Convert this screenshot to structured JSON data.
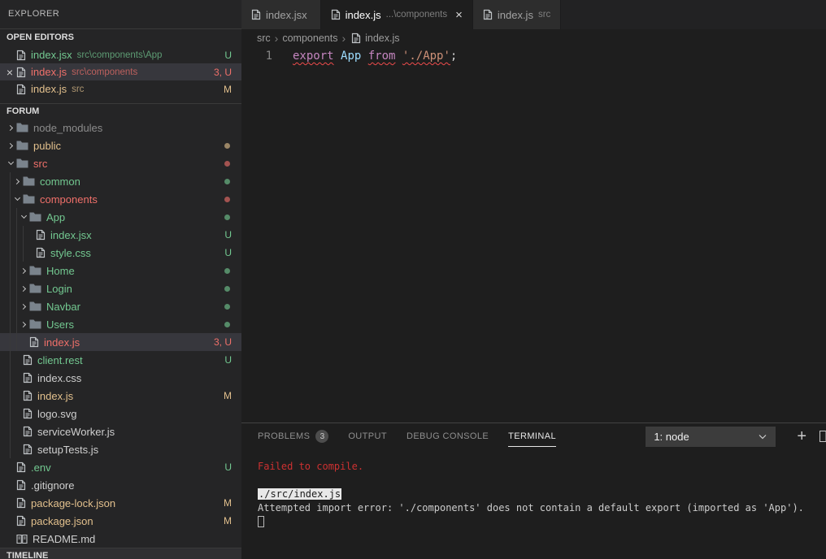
{
  "colors": {
    "green": "#73C991",
    "red": "#F0706A",
    "yellow": "#E2C08D",
    "gray": "#8C8C8C",
    "default": "#CFCFCF",
    "terminal_red": "#CD3131",
    "squiggle": "#F14C4C",
    "selection_bg": "#37373D"
  },
  "sidebar": {
    "title": "EXPLORER",
    "open_editors": {
      "header": "OPEN EDITORS",
      "items": [
        {
          "name": "index.jsx",
          "desc": "src\\components\\App",
          "badge": "U",
          "color": "green",
          "selected": false,
          "close": false
        },
        {
          "name": "index.js",
          "desc": "src\\components",
          "badge": "3, U",
          "color": "red",
          "selected": true,
          "close": true
        },
        {
          "name": "index.js",
          "desc": "src",
          "badge": "M",
          "color": "yellow",
          "selected": false,
          "close": false
        }
      ]
    },
    "tree": {
      "header": "FORUM",
      "items": [
        {
          "type": "folder",
          "level": 0,
          "name": "node_modules",
          "expanded": false,
          "color": "gray",
          "dot": ""
        },
        {
          "type": "folder",
          "level": 0,
          "name": "public",
          "expanded": false,
          "color": "yellow",
          "dot": "yellow"
        },
        {
          "type": "folder",
          "level": 0,
          "name": "src",
          "expanded": true,
          "color": "red",
          "dot": "red"
        },
        {
          "type": "folder",
          "level": 1,
          "name": "common",
          "expanded": false,
          "color": "green",
          "dot": "green"
        },
        {
          "type": "folder",
          "level": 1,
          "name": "components",
          "expanded": true,
          "color": "red",
          "dot": "red"
        },
        {
          "type": "folder",
          "level": 2,
          "name": "App",
          "expanded": true,
          "color": "green",
          "dot": "green"
        },
        {
          "type": "file",
          "level": 3,
          "name": "index.jsx",
          "badge": "U",
          "color": "green",
          "selected": false
        },
        {
          "type": "file",
          "level": 3,
          "name": "style.css",
          "badge": "U",
          "color": "green",
          "selected": false
        },
        {
          "type": "folder",
          "level": 2,
          "name": "Home",
          "expanded": false,
          "color": "green",
          "dot": "green"
        },
        {
          "type": "folder",
          "level": 2,
          "name": "Login",
          "expanded": false,
          "color": "green",
          "dot": "green"
        },
        {
          "type": "folder",
          "level": 2,
          "name": "Navbar",
          "expanded": false,
          "color": "green",
          "dot": "green"
        },
        {
          "type": "folder",
          "level": 2,
          "name": "Users",
          "expanded": false,
          "color": "green",
          "dot": "green"
        },
        {
          "type": "file",
          "level": 2,
          "name": "index.js",
          "badge": "3, U",
          "color": "red",
          "selected": true
        },
        {
          "type": "file",
          "level": 1,
          "name": "client.rest",
          "badge": "U",
          "color": "green",
          "selected": false
        },
        {
          "type": "file",
          "level": 1,
          "name": "index.css",
          "badge": "",
          "color": "default",
          "selected": false
        },
        {
          "type": "file",
          "level": 1,
          "name": "index.js",
          "badge": "M",
          "color": "yellow",
          "selected": false
        },
        {
          "type": "file",
          "level": 1,
          "name": "logo.svg",
          "badge": "",
          "color": "default",
          "selected": false
        },
        {
          "type": "file",
          "level": 1,
          "name": "serviceWorker.js",
          "badge": "",
          "color": "default",
          "selected": false
        },
        {
          "type": "file",
          "level": 1,
          "name": "setupTests.js",
          "badge": "",
          "color": "default",
          "selected": false
        },
        {
          "type": "file",
          "level": 0,
          "name": ".env",
          "badge": "U",
          "color": "green",
          "selected": false
        },
        {
          "type": "file",
          "level": 0,
          "name": ".gitignore",
          "badge": "",
          "color": "default",
          "selected": false
        },
        {
          "type": "file",
          "level": 0,
          "name": "package-lock.json",
          "badge": "M",
          "color": "yellow",
          "selected": false
        },
        {
          "type": "file",
          "level": 0,
          "name": "package.json",
          "badge": "M",
          "color": "yellow",
          "selected": false
        },
        {
          "type": "file",
          "level": 0,
          "name": "README.md",
          "badge": "",
          "color": "default",
          "selected": false,
          "icon": "book"
        }
      ]
    },
    "timeline_header": "TIMELINE"
  },
  "editor": {
    "tabs": [
      {
        "name": "index.jsx",
        "desc": "",
        "active": false,
        "close": false
      },
      {
        "name": "index.js",
        "desc": "...\\components",
        "active": true,
        "close": true
      },
      {
        "name": "index.js",
        "desc": "src",
        "active": false,
        "close": false
      }
    ],
    "breadcrumb": [
      "src",
      "components",
      "index.js"
    ],
    "line_number": "1",
    "code_tokens": [
      {
        "text": "export",
        "color": "#C586C0",
        "squiggle": true
      },
      {
        "text": " ",
        "color": "#D4D4D4",
        "squiggle": false
      },
      {
        "text": "App",
        "color": "#9CDCFE",
        "squiggle": false
      },
      {
        "text": " ",
        "color": "#D4D4D4",
        "squiggle": false
      },
      {
        "text": "from",
        "color": "#C586C0",
        "squiggle": true
      },
      {
        "text": " ",
        "color": "#D4D4D4",
        "squiggle": false
      },
      {
        "text": "'./App'",
        "color": "#CE9178",
        "squiggle": true
      },
      {
        "text": ";",
        "color": "#D4D4D4",
        "squiggle": false
      }
    ]
  },
  "panel": {
    "tabs": [
      {
        "label": "PROBLEMS",
        "badge": "3",
        "active": false
      },
      {
        "label": "OUTPUT",
        "badge": "",
        "active": false
      },
      {
        "label": "DEBUG CONSOLE",
        "badge": "",
        "active": false
      },
      {
        "label": "TERMINAL",
        "badge": "",
        "active": true
      }
    ],
    "terminal_select": "1: node",
    "terminal_lines": [
      {
        "text": "Failed to compile.",
        "style": "error"
      },
      {
        "text": "",
        "style": "plain"
      },
      {
        "text": "./src/index.js",
        "style": "highlight"
      },
      {
        "text": "Attempted import error: './components' does not contain a default export (imported as 'App').",
        "style": "plain"
      },
      {
        "text": "",
        "style": "cursor"
      }
    ]
  }
}
